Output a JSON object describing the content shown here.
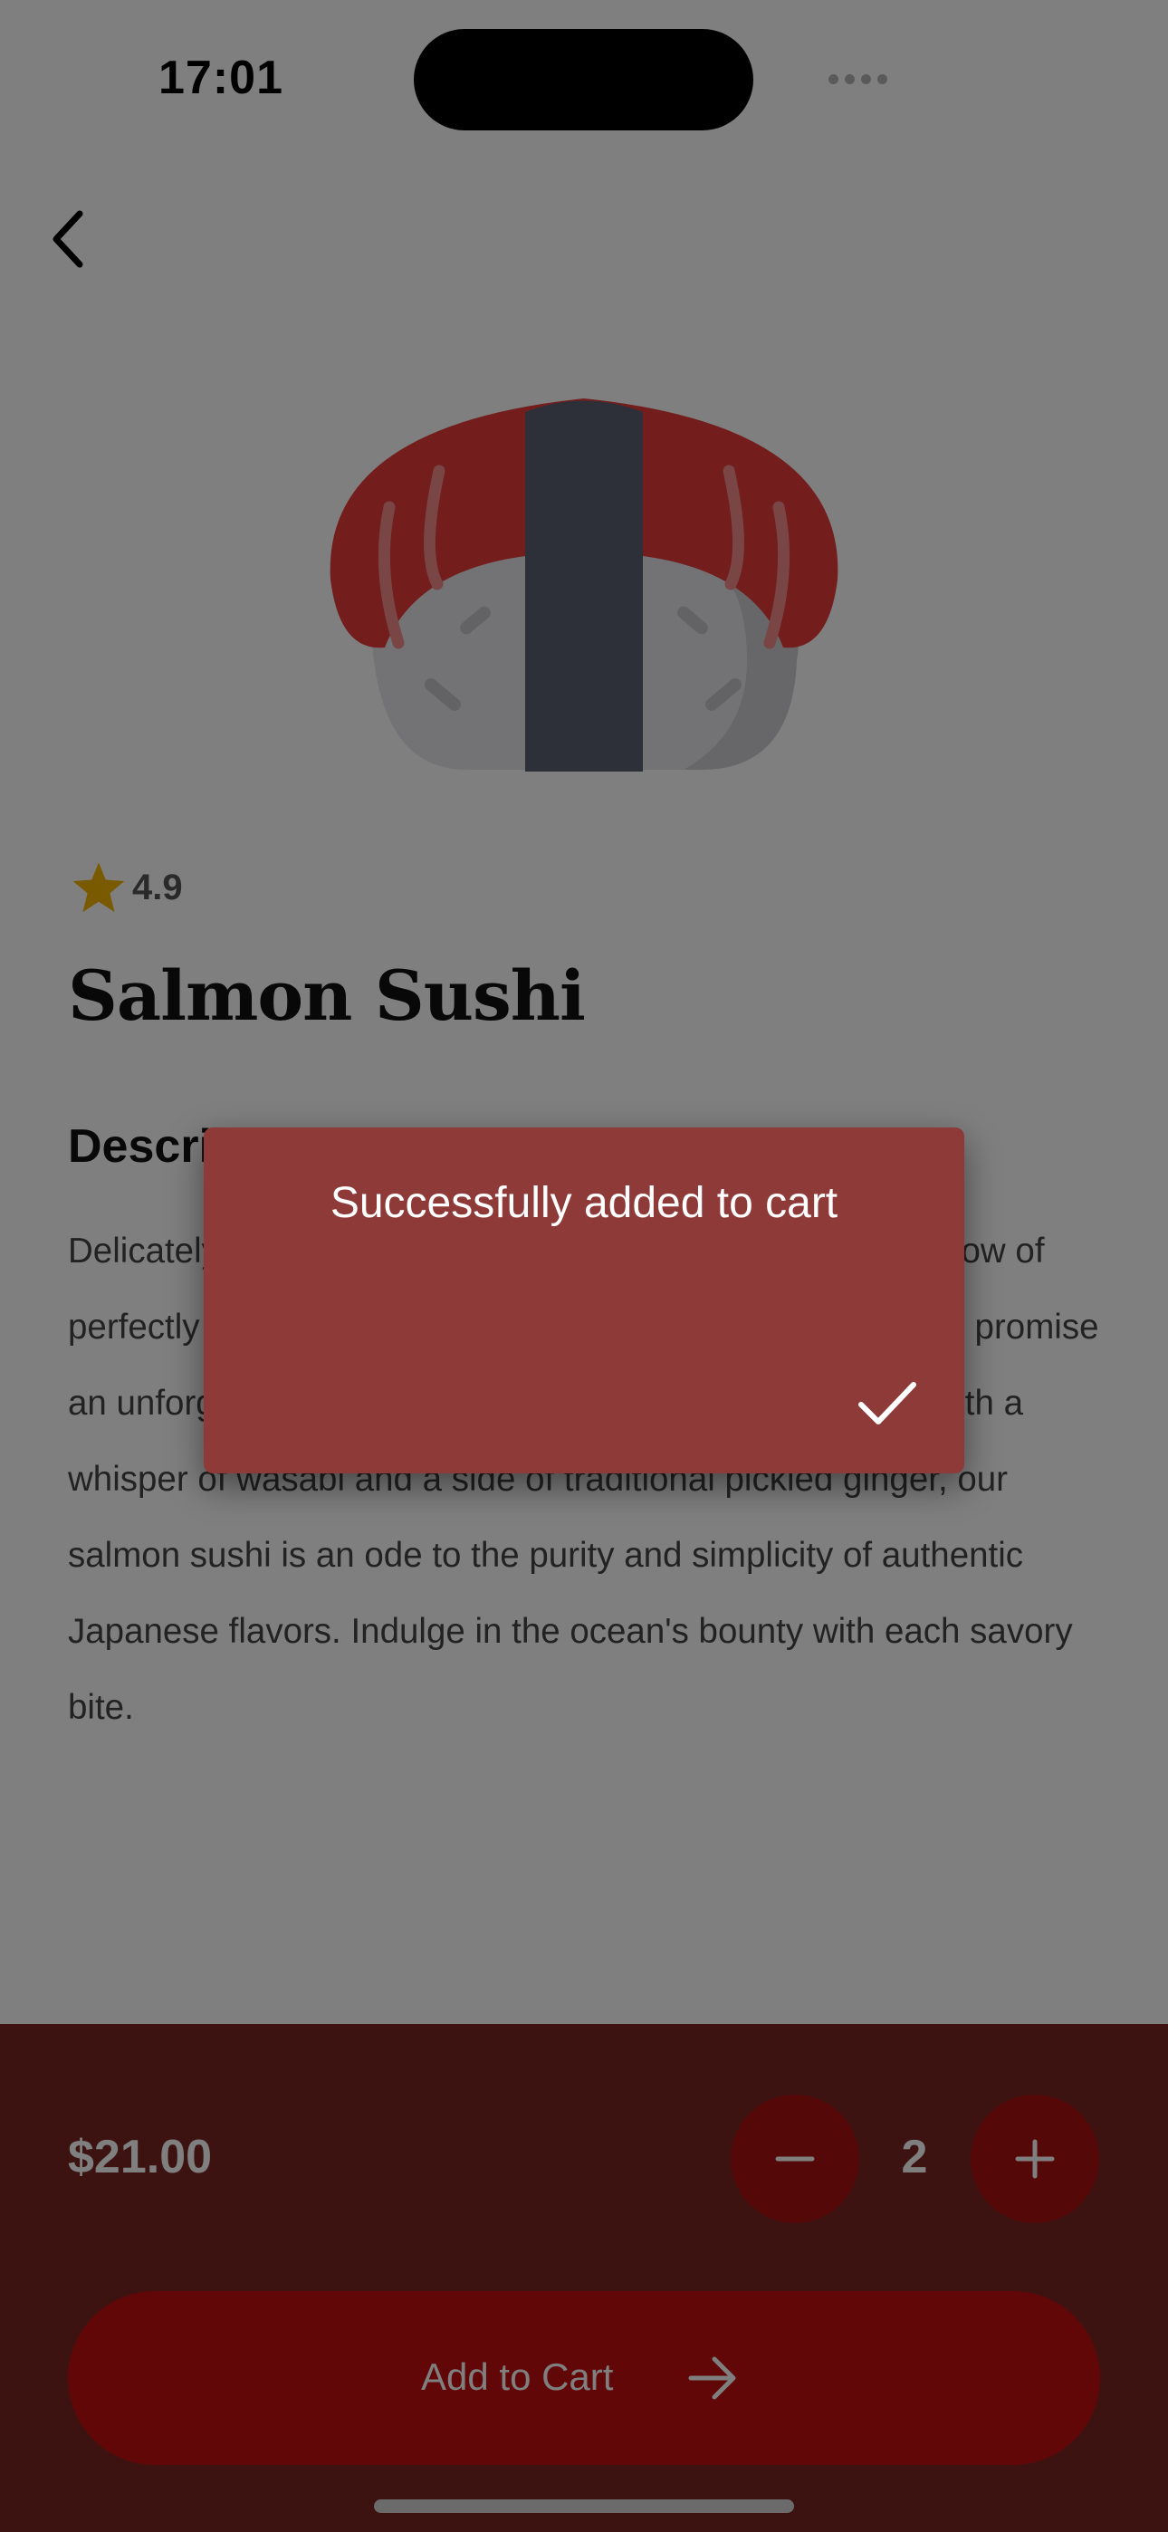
{
  "status_bar": {
    "time": "17:01"
  },
  "product": {
    "rating": "4.9",
    "name": "Salmon Sushi",
    "description_heading": "Description",
    "description": "Delicately sliced, fresh salmon drapes elegantly over a pillow of perfectly seasoned rice. Its vibrant hue and buttery texture promise an unforgettable melt-in-your-mouth experience. Paired with a whisper of wasabi and a side of traditional pickled ginger, our salmon sushi is an ode to the purity and simplicity of authentic Japanese flavors. Indulge in the ocean's bounty with each savory bite."
  },
  "purchase": {
    "price": "$21.00",
    "quantity": "2",
    "add_to_cart_label": "Add to Cart"
  },
  "dialog": {
    "message": "Successfully added to cart"
  },
  "colors": {
    "primary": "#c30e0e",
    "bottom_bar": "#7b2623",
    "dialog": "#8d3a38",
    "star": "#f4b400"
  },
  "icons": [
    "back-chevron-icon",
    "star-icon",
    "minus-icon",
    "plus-icon",
    "arrow-right-icon",
    "check-icon",
    "wifi-icon",
    "battery-icon"
  ]
}
